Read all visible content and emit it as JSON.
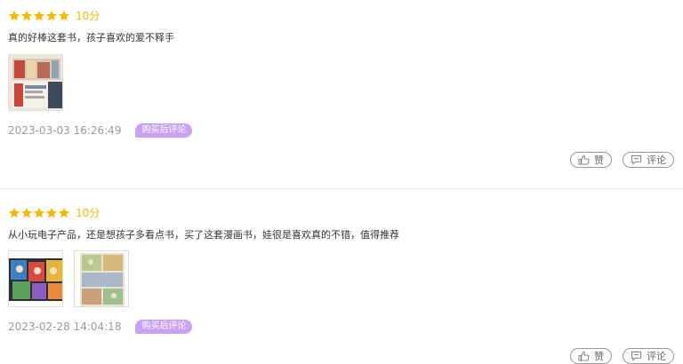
{
  "colors": {
    "star": "#f5b800",
    "score_text": "#f5b800",
    "badge_bg": "#c8a2f0",
    "date_text": "#9a9a9a"
  },
  "reviews": [
    {
      "stars": 5,
      "score": "10分",
      "text": "真的好棒这套书，孩子喜欢的爱不释手",
      "images": [
        "book-photo"
      ],
      "date": "2023-03-03 16:26:49",
      "badge": "购买后评论",
      "like_label": "赞",
      "comment_label": "评论"
    },
    {
      "stars": 5,
      "score": "10分",
      "text": "从小玩电子产品，还是想孩子多看点书，买了这套漫画书，娃很是喜欢真的不错，值得推荐",
      "images": [
        "comic-books-photo",
        "comic-page-photo"
      ],
      "date": "2023-02-28 14:04:18",
      "badge": "购买后评论",
      "like_label": "赞",
      "comment_label": "评论"
    }
  ]
}
